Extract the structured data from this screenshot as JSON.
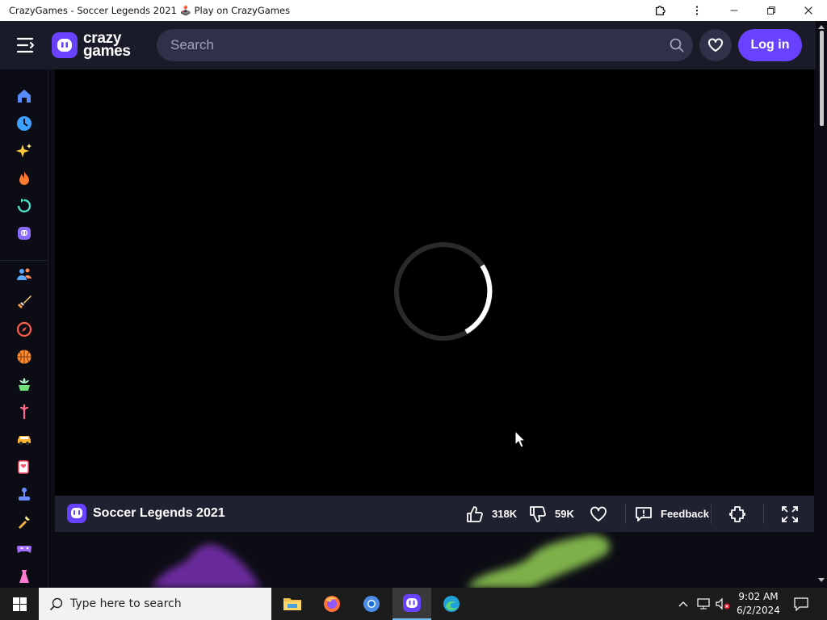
{
  "window": {
    "title": "CrazyGames - Soccer Legends 2021 🕹️ Play on CrazyGames"
  },
  "header": {
    "logo_line1": "crazy",
    "logo_line2": "games",
    "search_placeholder": "Search",
    "login_label": "Log in"
  },
  "sidebar": {
    "items": [
      {
        "icon": "home-icon",
        "color": "#5b8cff"
      },
      {
        "icon": "recent-clock-icon",
        "color": "#3ea1ff"
      },
      {
        "icon": "sparkle-new-icon",
        "color": "#ffc93c"
      },
      {
        "icon": "fire-trending-icon",
        "color": "#ff7a2f"
      },
      {
        "icon": "updated-refresh-icon",
        "color": "#4fe0c8"
      },
      {
        "icon": "originals-icon",
        "color": "#8a6bff"
      },
      {
        "icon": "multiplayer-icon",
        "color": "#5aa8ff"
      },
      {
        "icon": "action-sword-icon",
        "color": "#ffd26b"
      },
      {
        "icon": "adventure-compass-icon",
        "color": "#ff5b4a"
      },
      {
        "icon": "basketball-icon",
        "color": "#ff8a2d"
      },
      {
        "icon": "casual-flower-icon",
        "color": "#6fe07a"
      },
      {
        "icon": "clicker-icon",
        "color": "#ff6a8d"
      },
      {
        "icon": "driving-car-icon",
        "color": "#ffb330"
      },
      {
        "icon": "cards-icon",
        "color": "#ff4d6a"
      },
      {
        "icon": "controller-stick-icon",
        "color": "#6b8cff"
      },
      {
        "icon": "shooting-icon",
        "color": "#ffb347"
      },
      {
        "icon": "gamepad-icon",
        "color": "#a46bff"
      },
      {
        "icon": "dress-up-icon",
        "color": "#ff7ad0"
      }
    ]
  },
  "game": {
    "title": "Soccer Legends 2021",
    "likes": "318K",
    "dislikes": "59K",
    "feedback_label": "Feedback"
  },
  "taskbar": {
    "search_placeholder": "Type here to search",
    "time": "9:02 AM",
    "date": "6/2/2024"
  },
  "colors": {
    "accent": "#6842ff",
    "header_bg": "#191b28",
    "page_bg": "#0c0d14"
  }
}
